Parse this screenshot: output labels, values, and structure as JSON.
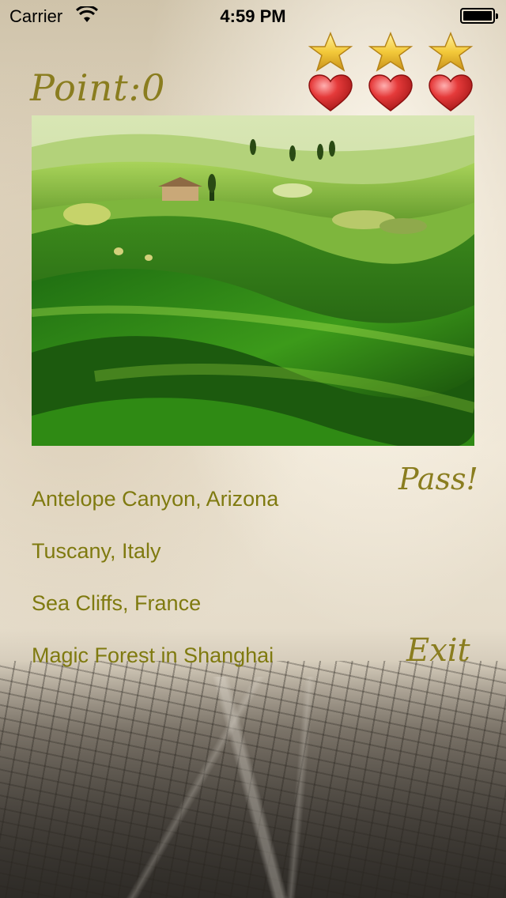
{
  "status_bar": {
    "carrier": "Carrier",
    "time": "4:59 PM"
  },
  "game": {
    "points_label": "Point:0",
    "stars": 3,
    "lives": 3
  },
  "photo": {
    "icon": "landscape-photo"
  },
  "options": [
    {
      "label": "Antelope Canyon, Arizona"
    },
    {
      "label": "Tuscany, Italy"
    },
    {
      "label": "Sea Cliffs, France"
    },
    {
      "label": "Magic Forest in Shanghai"
    }
  ],
  "actions": {
    "pass_label": "Pass!",
    "exit_label": "Exit"
  },
  "colors": {
    "accent_text": "#8a7d1f",
    "option_text": "#7f7a0f"
  }
}
